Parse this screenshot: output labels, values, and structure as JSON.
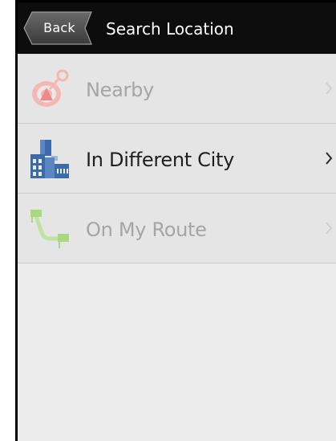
{
  "header": {
    "back_label": "Back",
    "title": "Search Location"
  },
  "menu": {
    "items": [
      {
        "label": "Nearby",
        "icon": "target-pin-icon",
        "enabled": false
      },
      {
        "label": "In Different City",
        "icon": "city-buildings-icon",
        "enabled": true
      },
      {
        "label": "On My Route",
        "icon": "route-flags-icon",
        "enabled": false
      }
    ]
  },
  "colors": {
    "header_bg": "#0d0d0d",
    "list_bg": "#e5e5e5",
    "disabled_text": "#a5a5a5",
    "active_text": "#1f1f1f"
  }
}
